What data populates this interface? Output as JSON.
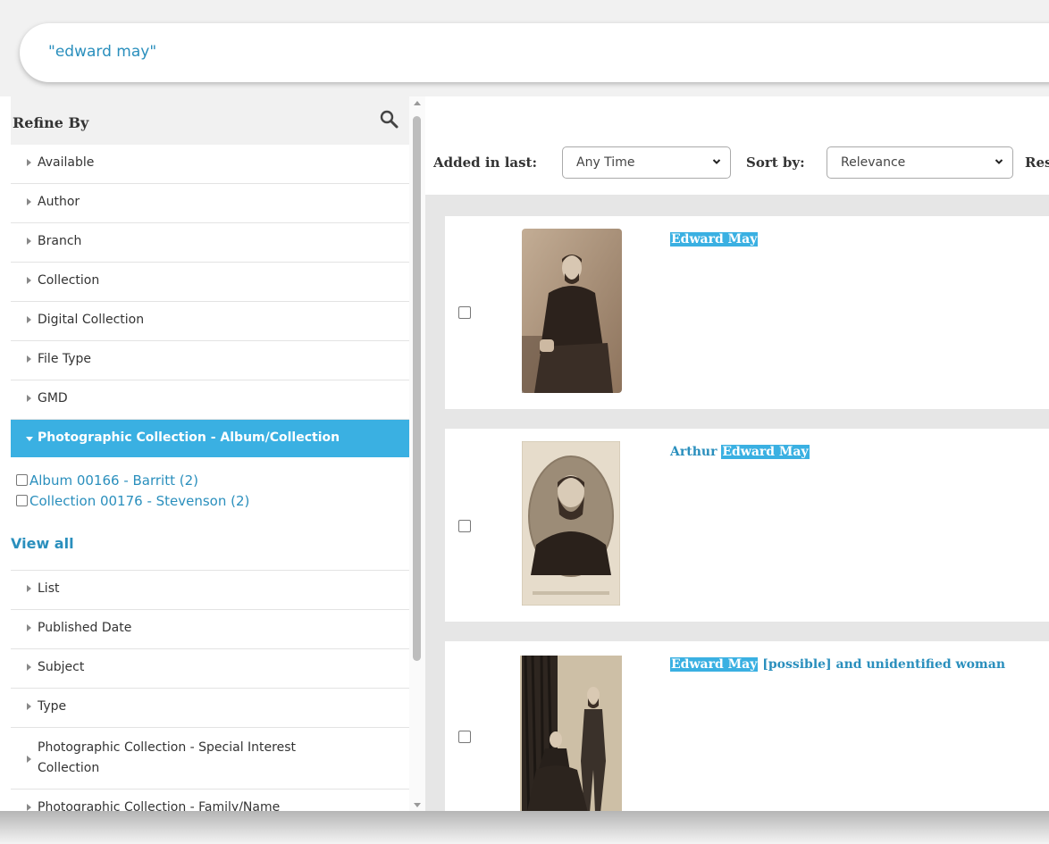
{
  "search": {
    "query": "\"edward may\""
  },
  "sidebar": {
    "title": "Refine By",
    "search_icon": "magnifier-icon",
    "facets_top": [
      {
        "label": "Available"
      },
      {
        "label": "Author"
      },
      {
        "label": "Branch"
      },
      {
        "label": "Collection"
      },
      {
        "label": "Digital Collection"
      },
      {
        "label": "File Type"
      },
      {
        "label": "GMD"
      }
    ],
    "active_facet": {
      "label": "Photographic Collection - Album/Collection",
      "options": [
        {
          "label": "Album 00166 - Barritt (2)"
        },
        {
          "label": "Collection 00176 - Stevenson (2)"
        }
      ],
      "view_all": "View all"
    },
    "facets_bottom": [
      {
        "label": "List"
      },
      {
        "label": "Published Date"
      },
      {
        "label": "Subject"
      },
      {
        "label": "Type"
      },
      {
        "label": "Photographic Collection - Special Interest Collection"
      },
      {
        "label": "Photographic Collection - Family/Name"
      }
    ]
  },
  "toolbar": {
    "added_label": "Added in last:",
    "added_value": "Any Time",
    "sort_label": "Sort by:",
    "sort_value": "Relevance",
    "extra_label": "Res"
  },
  "results": [
    {
      "title_pre": "",
      "title_hl": "Edward May",
      "title_post": ""
    },
    {
      "title_pre": "Arthur ",
      "title_hl": "Edward May",
      "title_post": ""
    },
    {
      "title_pre": "",
      "title_hl": "Edward May",
      "title_post": " [possible] and unidentified woman"
    }
  ],
  "colors": {
    "accent": "#3ab0e2",
    "link": "#2a8fbd",
    "panel_bg": "#f1f1f1",
    "results_bg": "#e6e6e6"
  }
}
